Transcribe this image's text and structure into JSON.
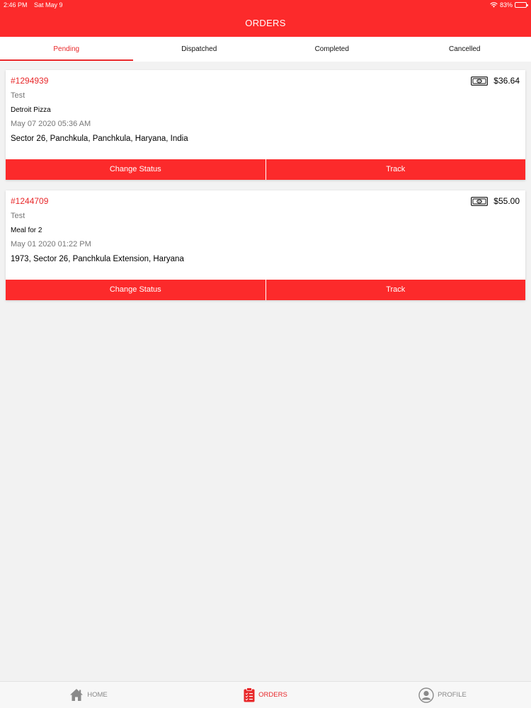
{
  "status_bar": {
    "time": "2:46 PM",
    "date": "Sat May 9",
    "battery": "83%",
    "battery_level": 0.83
  },
  "header": {
    "title": "ORDERS"
  },
  "tabs": [
    {
      "label": "Pending",
      "active": true
    },
    {
      "label": "Dispatched",
      "active": false
    },
    {
      "label": "Completed",
      "active": false
    },
    {
      "label": "Cancelled",
      "active": false
    }
  ],
  "orders": [
    {
      "id": "#1294939",
      "amount": "$36.64",
      "customer": "Test",
      "item": "Detroit Pizza",
      "date": "May 07 2020 05:36 AM",
      "address": "Sector 26, Panchkula, Panchkula, Haryana, India",
      "change_status_label": "Change Status",
      "track_label": "Track"
    },
    {
      "id": "#1244709",
      "amount": "$55.00",
      "customer": "Test",
      "item": "Meal for 2",
      "date": "May 01 2020 01:22 PM",
      "address": "1973, Sector 26, Panchkula Extension, Haryana",
      "change_status_label": "Change Status",
      "track_label": "Track"
    }
  ],
  "bottom_nav": [
    {
      "label": "HOME",
      "icon": "home-icon",
      "active": false
    },
    {
      "label": "ORDERS",
      "icon": "orders-clipboard-icon",
      "active": true
    },
    {
      "label": "PROFILE",
      "icon": "profile-icon",
      "active": false
    }
  ],
  "colors": {
    "accent": "#fc2a2b",
    "accent_text": "#e8282a",
    "background": "#f2f2f2"
  }
}
